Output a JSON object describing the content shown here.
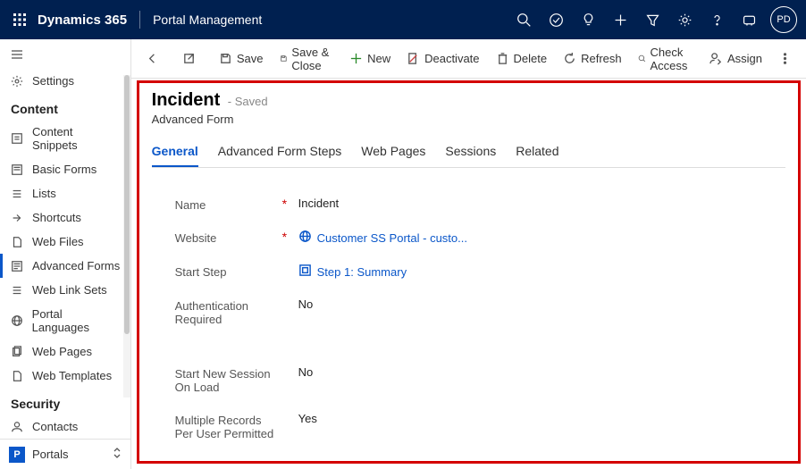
{
  "header": {
    "brand": "Dynamics 365",
    "appname": "Portal Management",
    "avatar_initials": "PD"
  },
  "sidebar": {
    "settings_label": "Settings",
    "section_content": "Content",
    "items_content": [
      {
        "label": "Content Snippets"
      },
      {
        "label": "Basic Forms"
      },
      {
        "label": "Lists"
      },
      {
        "label": "Shortcuts"
      },
      {
        "label": "Web Files"
      },
      {
        "label": "Advanced Forms"
      },
      {
        "label": "Web Link Sets"
      },
      {
        "label": "Portal Languages"
      },
      {
        "label": "Web Pages"
      },
      {
        "label": "Web Templates"
      }
    ],
    "section_security": "Security",
    "items_security": [
      {
        "label": "Contacts"
      }
    ],
    "area_box": "P",
    "area_label": "Portals"
  },
  "cmdbar": {
    "save": "Save",
    "save_close": "Save & Close",
    "new": "New",
    "deactivate": "Deactivate",
    "delete": "Delete",
    "refresh": "Refresh",
    "check_access": "Check Access",
    "assign": "Assign"
  },
  "page": {
    "title": "Incident",
    "saved_suffix": "- Saved",
    "subtitle": "Advanced Form",
    "tabs": {
      "general": "General",
      "steps": "Advanced Form Steps",
      "webpages": "Web Pages",
      "sessions": "Sessions",
      "related": "Related"
    },
    "fields": {
      "name_label": "Name",
      "name_value": "Incident",
      "website_label": "Website",
      "website_value": "Customer SS Portal - custo...",
      "startstep_label": "Start Step",
      "startstep_value": "Step 1: Summary",
      "auth_label": "Authentication Required",
      "auth_value": "No",
      "newsession_label": "Start New Session On Load",
      "newsession_value": "No",
      "multi_label": "Multiple Records Per User Permitted",
      "multi_value": "Yes"
    }
  }
}
